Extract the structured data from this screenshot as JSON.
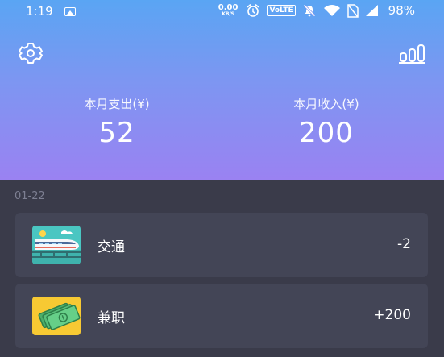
{
  "status_bar": {
    "time": "1:19",
    "net_speed_value": "0.00",
    "net_speed_unit": "KB/S",
    "volte": "VoLTE",
    "battery": "98%"
  },
  "header": {
    "settings_icon": "gear-icon",
    "stats_icon": "bar-chart-icon",
    "expense_label": "本月支出(¥)",
    "expense_value": "52",
    "income_label": "本月收入(¥)",
    "income_value": "200"
  },
  "records": {
    "date": "01-22",
    "items": [
      {
        "icon": "train-icon",
        "category": "交通",
        "amount": "-2"
      },
      {
        "icon": "money-icon",
        "category": "兼职",
        "amount": "+200"
      }
    ]
  },
  "colors": {
    "header_gradient_top": "#5aa5f3",
    "header_gradient_bottom": "#9a82f2",
    "body_background": "#3a3b4a",
    "card_background": "#434556",
    "date_text": "#7d7f92"
  }
}
